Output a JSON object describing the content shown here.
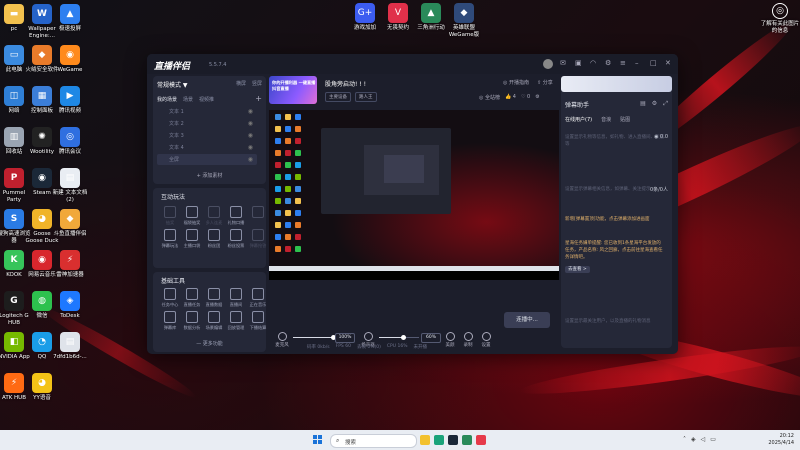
{
  "desktop": {
    "left_icons": [
      {
        "label": "pc",
        "color": "#f2c14e",
        "glyph": "▬"
      },
      {
        "label": "Wallpaper Engine:...",
        "color": "#2563c9",
        "glyph": "W"
      },
      {
        "label": "极速投屏",
        "color": "#2d7ff0",
        "glyph": "▲"
      },
      {
        "label": "此电脑",
        "color": "#3b8be0",
        "glyph": "▭"
      },
      {
        "label": "火绒安全软件",
        "color": "#e97b2a",
        "glyph": "◆"
      },
      {
        "label": "WeGame",
        "color": "#ff8a1c",
        "glyph": "◉"
      },
      {
        "label": "网络",
        "color": "#2f7fd6",
        "glyph": "◫"
      },
      {
        "label": "控制面板",
        "color": "#3b7ed8",
        "glyph": "▦"
      },
      {
        "label": "腾讯视频",
        "color": "#1e88e5",
        "glyph": "▶"
      },
      {
        "label": "回收站",
        "color": "#9aa4b2",
        "glyph": "▥"
      },
      {
        "label": "Wootility",
        "color": "#222",
        "glyph": "✺"
      },
      {
        "label": "腾讯会议",
        "color": "#2f6fe0",
        "glyph": "◎"
      },
      {
        "label": "Pummel Party",
        "color": "#c0202e",
        "glyph": "P"
      },
      {
        "label": "Steam",
        "color": "#1b2838",
        "glyph": "◉"
      },
      {
        "label": "新建 文本文档 (2)",
        "color": "#e9edf3",
        "glyph": "▤"
      },
      {
        "label": "搜狗高速浏览器",
        "color": "#2a7be4",
        "glyph": "S"
      },
      {
        "label": "Goose Goose Duck",
        "color": "#f0b429",
        "glyph": "◕"
      },
      {
        "label": "斗鱼直播伴侣",
        "color": "#f1a83a",
        "glyph": "◆"
      },
      {
        "label": "KOOK",
        "color": "#36c45a",
        "glyph": "K"
      },
      {
        "label": "网易云音乐",
        "color": "#d8262d",
        "glyph": "◉"
      },
      {
        "label": "雷神加速器",
        "color": "#d92f2f",
        "glyph": "⚡"
      },
      {
        "label": "Logitech G HUB",
        "color": "#1d1d1d",
        "glyph": "G"
      },
      {
        "label": "微信",
        "color": "#2dc14e",
        "glyph": "◍"
      },
      {
        "label": "ToDesk",
        "color": "#1e78ff",
        "glyph": "◈"
      },
      {
        "label": "NVIDIA App",
        "color": "#76b900",
        "glyph": "◧"
      },
      {
        "label": "QQ",
        "color": "#1a9de8",
        "glyph": "◔"
      },
      {
        "label": "7dfd1b6d-...",
        "color": "#dfe3ea",
        "glyph": "▤"
      },
      {
        "label": "ATK HUB",
        "color": "#ff6a13",
        "glyph": "⚡"
      },
      {
        "label": "YY语音",
        "color": "#f4c317",
        "glyph": "◕"
      }
    ],
    "top_icons": [
      {
        "label": "游戏加加",
        "color": "#3c5cf0",
        "glyph": "G+"
      },
      {
        "label": "无畏契约",
        "color": "#e0304a",
        "glyph": "V"
      },
      {
        "label": "三角洲行动",
        "color": "#2a8a5a",
        "glyph": "▲"
      },
      {
        "label": "英雄联盟 WeGame版",
        "color": "#2f4a7a",
        "glyph": "◆"
      }
    ],
    "right_icon": {
      "label": "了解有关此图片的信息",
      "glyph": "◎"
    }
  },
  "app": {
    "logo": "直播伴侣",
    "version": "5.5.7.4",
    "left": {
      "mode": "常规模式 ▼",
      "mode_links": [
        "横屏",
        "竖屏"
      ],
      "scene_tabs": [
        "我的场景",
        "场景",
        "视频推"
      ],
      "sources": [
        "文本 1",
        "文本 2",
        "文本 3",
        "文本 4",
        "全屏"
      ],
      "add_source": "+ 添加素材",
      "interactive_title": "互动玩法",
      "interactive": [
        {
          "label": "抽奖",
          "dim": true
        },
        {
          "label": "福袋抽奖",
          "dim": false
        },
        {
          "label": "多人连麦",
          "dim": true
        },
        {
          "label": "礼物口播",
          "dim": false
        },
        {
          "label": "",
          "dim": true
        },
        {
          "label": "弹幕玩法",
          "dim": false
        },
        {
          "label": "主播口袋",
          "dim": false
        },
        {
          "label": "粉丝团",
          "dim": false
        },
        {
          "label": "粉丝投票",
          "dim": false
        },
        {
          "label": "弹幕抢答",
          "dim": true
        }
      ],
      "basic_title": "基础工具",
      "basic": [
        {
          "label": "任务中心"
        },
        {
          "label": "直播任务"
        },
        {
          "label": "直播数据"
        },
        {
          "label": "直播间",
          "dim": false
        },
        {
          "label": "正在音乐"
        },
        {
          "label": "弹幕库"
        },
        {
          "label": "数据分析"
        },
        {
          "label": "场景编辑"
        },
        {
          "label": "回放管理"
        },
        {
          "label": "下播结算"
        }
      ],
      "more": "— 更多功能"
    },
    "center": {
      "banner_text": "你的开播利器 一键直播 抖音直播",
      "room_title": "股角旁启动! ! !",
      "room_tags": [
        "主要设备",
        "路人王"
      ],
      "open_live": "◎ 开播指南",
      "share": "⇪ 分享",
      "stats": [
        "◎ 全站榜",
        "👍 4",
        "♡ 0",
        "⚙"
      ],
      "mic_label": "麦克风",
      "mic_pct": "100%",
      "mic_level": 1.0,
      "speaker_label": "扬声器",
      "speaker_pct": "60%",
      "speaker_level": 0.6,
      "tools": [
        "美颜",
        "录制",
        "设置"
      ],
      "go_live": "连播中...",
      "status": [
        "码率 0kb/s",
        "FPS 60",
        "丢帧 0%(0)",
        "CPU 16%",
        "未开播"
      ]
    },
    "right": {
      "title": "弹幕助手",
      "tabs": [
        "在线用户(7)",
        "音浪",
        "贴图"
      ],
      "messages": [
        {
          "text": "设置显示礼物等信息，如礼物、进入直播间、欢迎等",
          "stat": "◉ 0.0",
          "bright": false
        },
        {
          "text": "设置显示弹幕相关信息，如弹幕、关注提示",
          "stat": "0条/0人",
          "bright": false
        },
        {
          "text": "新增[弹幕置顶]功能，点击弹幕添加进画面",
          "stat": "",
          "bright": true
        },
        {
          "text": "星海任务嫌单提醒: 您已收到1条星海平台发放的任务，产品名称: 风之回廊，点击前往星海查看任务详情吧。",
          "stat": "",
          "bright": true
        },
        {
          "text": "去查看 >",
          "stat": "",
          "bright": false
        },
        {
          "text": "设置显示最关注用户，以及直播的礼物消息",
          "stat": "",
          "bright": false
        }
      ]
    }
  },
  "taskbar": {
    "search": "搜索",
    "time": "20:12",
    "date": "2025/4/14"
  }
}
